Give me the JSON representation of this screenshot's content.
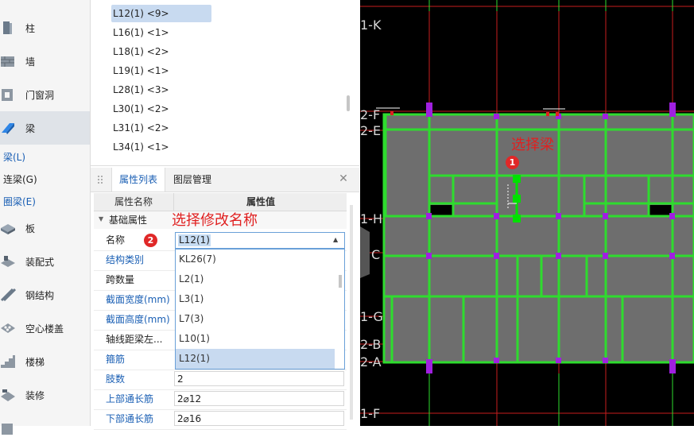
{
  "nav": {
    "items": [
      {
        "label": "柱",
        "icon": "column-icon"
      },
      {
        "label": "墙",
        "icon": "wall-icon"
      },
      {
        "label": "门窗洞",
        "icon": "door-window-icon"
      },
      {
        "label": "梁",
        "icon": "beam-icon"
      },
      {
        "label": "板",
        "icon": "slab-icon"
      },
      {
        "label": "装配式",
        "icon": "prefab-icon"
      },
      {
        "label": "钢结构",
        "icon": "steel-structure-icon"
      },
      {
        "label": "空心楼盖",
        "icon": "hollow-floor-icon"
      },
      {
        "label": "楼梯",
        "icon": "stair-icon"
      },
      {
        "label": "装修",
        "icon": "decoration-icon"
      }
    ],
    "sub_items": [
      "梁(L)",
      "连梁(G)",
      "圈梁(E)"
    ]
  },
  "beam_list": [
    "L12(1) <9>",
    "L16(1) <1>",
    "L18(1) <2>",
    "L19(1) <1>",
    "L28(1) <3>",
    "L30(1) <2>",
    "L31(1) <2>",
    "L34(1) <1>"
  ],
  "tabs": [
    "属性列表",
    "图层管理"
  ],
  "props": {
    "header_name": "属性名称",
    "header_value": "属性值",
    "group": "基础属性",
    "rows": [
      {
        "name": "名称",
        "value": "L12(1)",
        "blue": false
      },
      {
        "name": "结构类别",
        "value": "",
        "blue": true
      },
      {
        "name": "跨数量",
        "value": "",
        "blue": false
      },
      {
        "name": "截面宽度(mm)",
        "value": "",
        "blue": true
      },
      {
        "name": "截面高度(mm)",
        "value": "",
        "blue": true
      },
      {
        "name": "轴线距梁左...",
        "value": "",
        "blue": false
      },
      {
        "name": "箍筋",
        "value": "",
        "blue": true
      },
      {
        "name": "肢数",
        "value": "2",
        "blue": true
      },
      {
        "name": "上部通长筋",
        "value": "2⌀12",
        "blue": true
      },
      {
        "name": "下部通长筋",
        "value": "2⌀16",
        "blue": true
      }
    ]
  },
  "dropdown": {
    "current": "L12(1)",
    "options": [
      "KL26(7)",
      "L2(1)",
      "L3(1)",
      "L7(3)",
      "L10(1)",
      "L12(1)"
    ],
    "selected_index": 5
  },
  "annotations": {
    "rename_hint": "选择修改名称",
    "select_beam_hint": "选择梁",
    "badge1": "1",
    "badge2": "2"
  },
  "cad": {
    "axis_labels": [
      "1-K",
      "2-F",
      "2-E",
      "1-H",
      "C",
      "1-G",
      "2-B",
      "2-A",
      "1-F"
    ],
    "colors": {
      "background": "#000000",
      "beam": "#2edc2e",
      "slab": "#6e6e6e",
      "grid": "#cc2020",
      "column": "#a020e0",
      "selected": "#00e000"
    }
  }
}
